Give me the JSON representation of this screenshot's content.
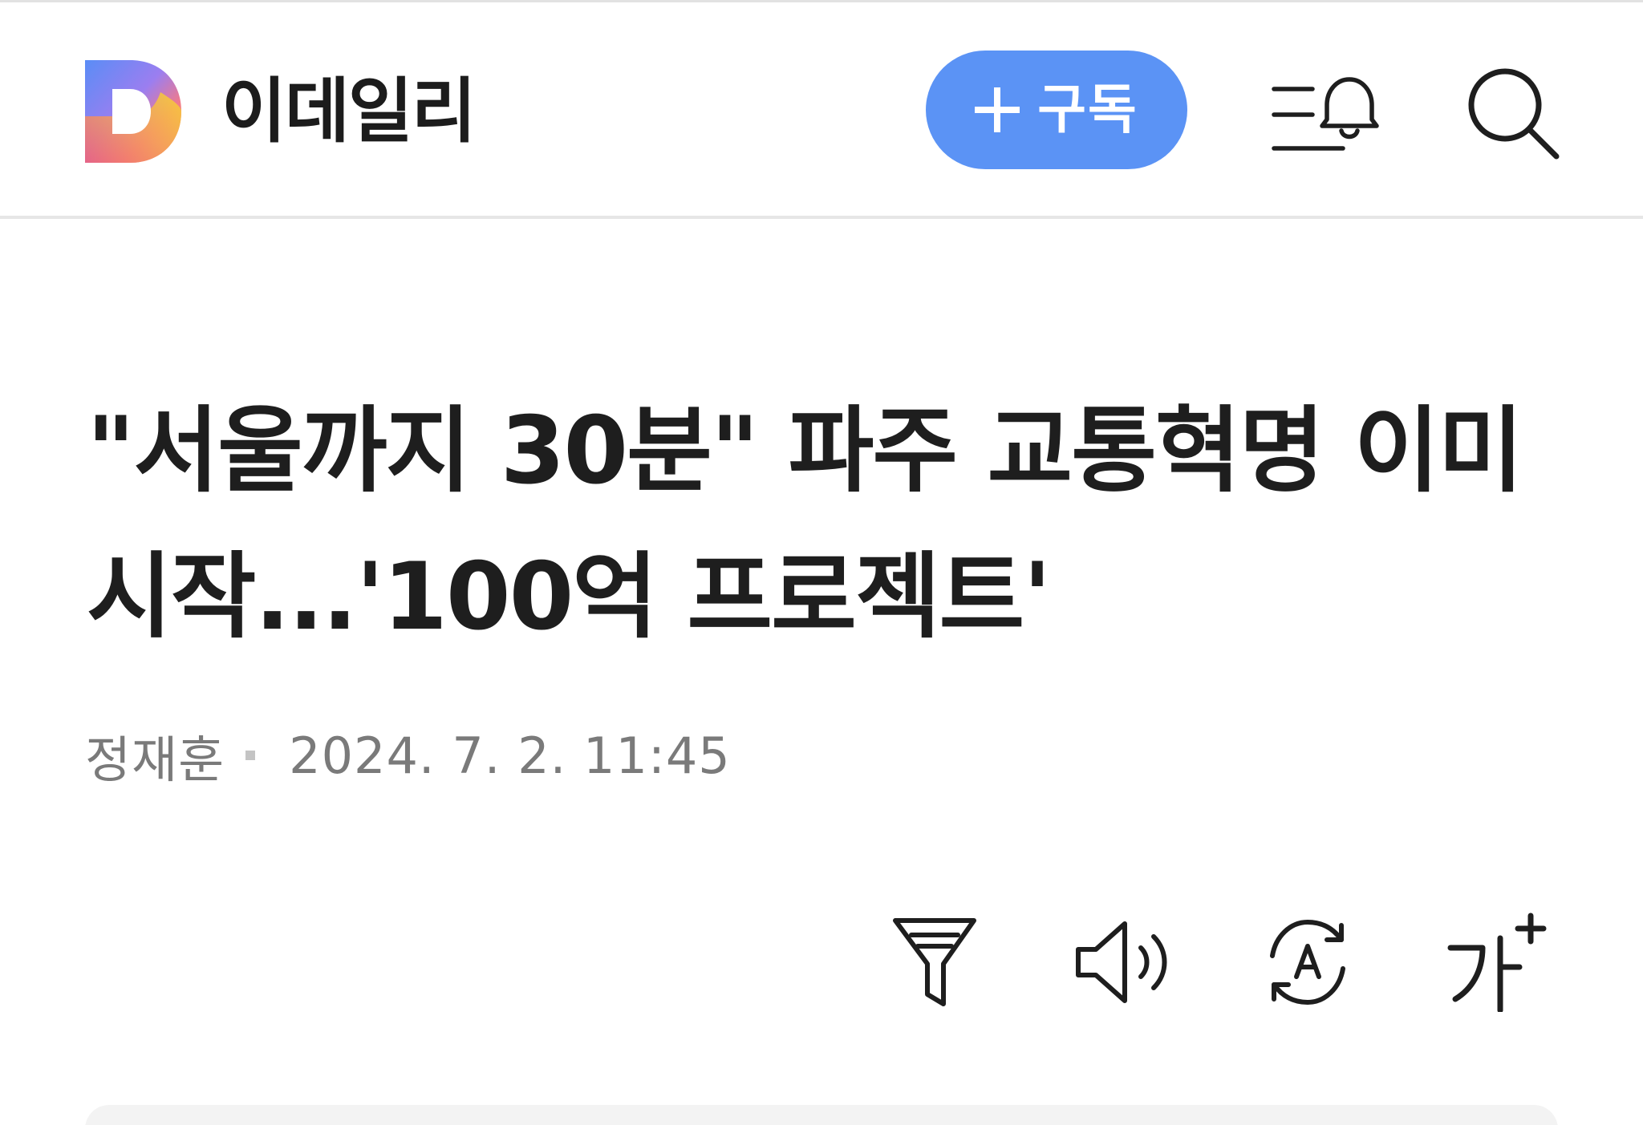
{
  "header": {
    "brand_name": "이데일리",
    "subscribe_label": "구독",
    "icons": {
      "logo": "edaily-d-logo",
      "plus": "plus-icon",
      "menu_bell": "menu-bell-icon",
      "search": "search-icon"
    }
  },
  "article": {
    "headline": "\"서울까지 30분\" 파주 교통혁명 이미 시작...'100억 프로젝트'",
    "author": "정재훈",
    "date": "2024. 7. 2. 11:45"
  },
  "toolbar": {
    "icons": [
      "filter-icon",
      "speaker-icon",
      "auto-translate-icon",
      "font-size-icon"
    ],
    "font_glyph": "가"
  },
  "colors": {
    "accent": "#5b93f5",
    "text_primary": "#1e1e1e",
    "text_meta": "#7a7a7a",
    "divider": "#e6e6e6"
  }
}
